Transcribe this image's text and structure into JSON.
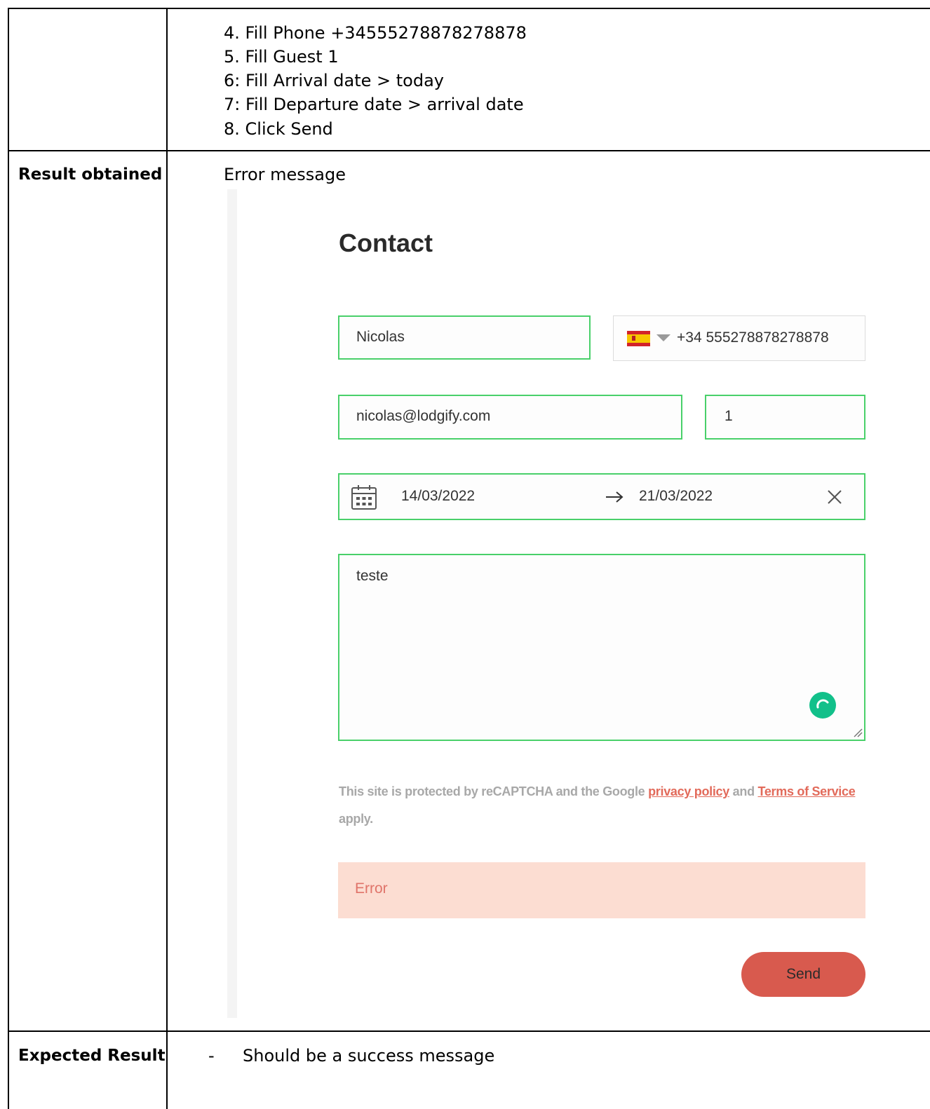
{
  "steps": [
    "4. Fill Phone +34555278878278878",
    "5. Fill Guest 1",
    "6: Fill Arrival date > today",
    "7: Fill Departure date > arrival date",
    "8. Click Send"
  ],
  "result": {
    "label": "Result obtained",
    "text": "Error message"
  },
  "expected": {
    "label": "Expected Result",
    "bullet": "-",
    "text": "Should be a success message"
  },
  "form": {
    "title": "Contact",
    "name_value": "Nicolas",
    "phone_flag_icon": "spain-flag-icon",
    "phone_value": "+34 555278878278878",
    "email_value": "nicolas@lodgify.com",
    "guests_value": "1",
    "arrival_date": "14/03/2022",
    "departure_date": "21/03/2022",
    "message_value": "teste",
    "recaptcha": {
      "prefix": "This site is protected by reCAPTCHA and the Google",
      "privacy_link": "privacy policy",
      "middle": "and",
      "terms_link": "Terms of Service",
      "suffix": "apply."
    },
    "error_text": "Error",
    "send_label": "Send",
    "colors": {
      "field_border": "#49d06a",
      "error_bg": "#fcddd2",
      "send_bg": "#d85a4e",
      "link": "#e26a5a"
    }
  }
}
